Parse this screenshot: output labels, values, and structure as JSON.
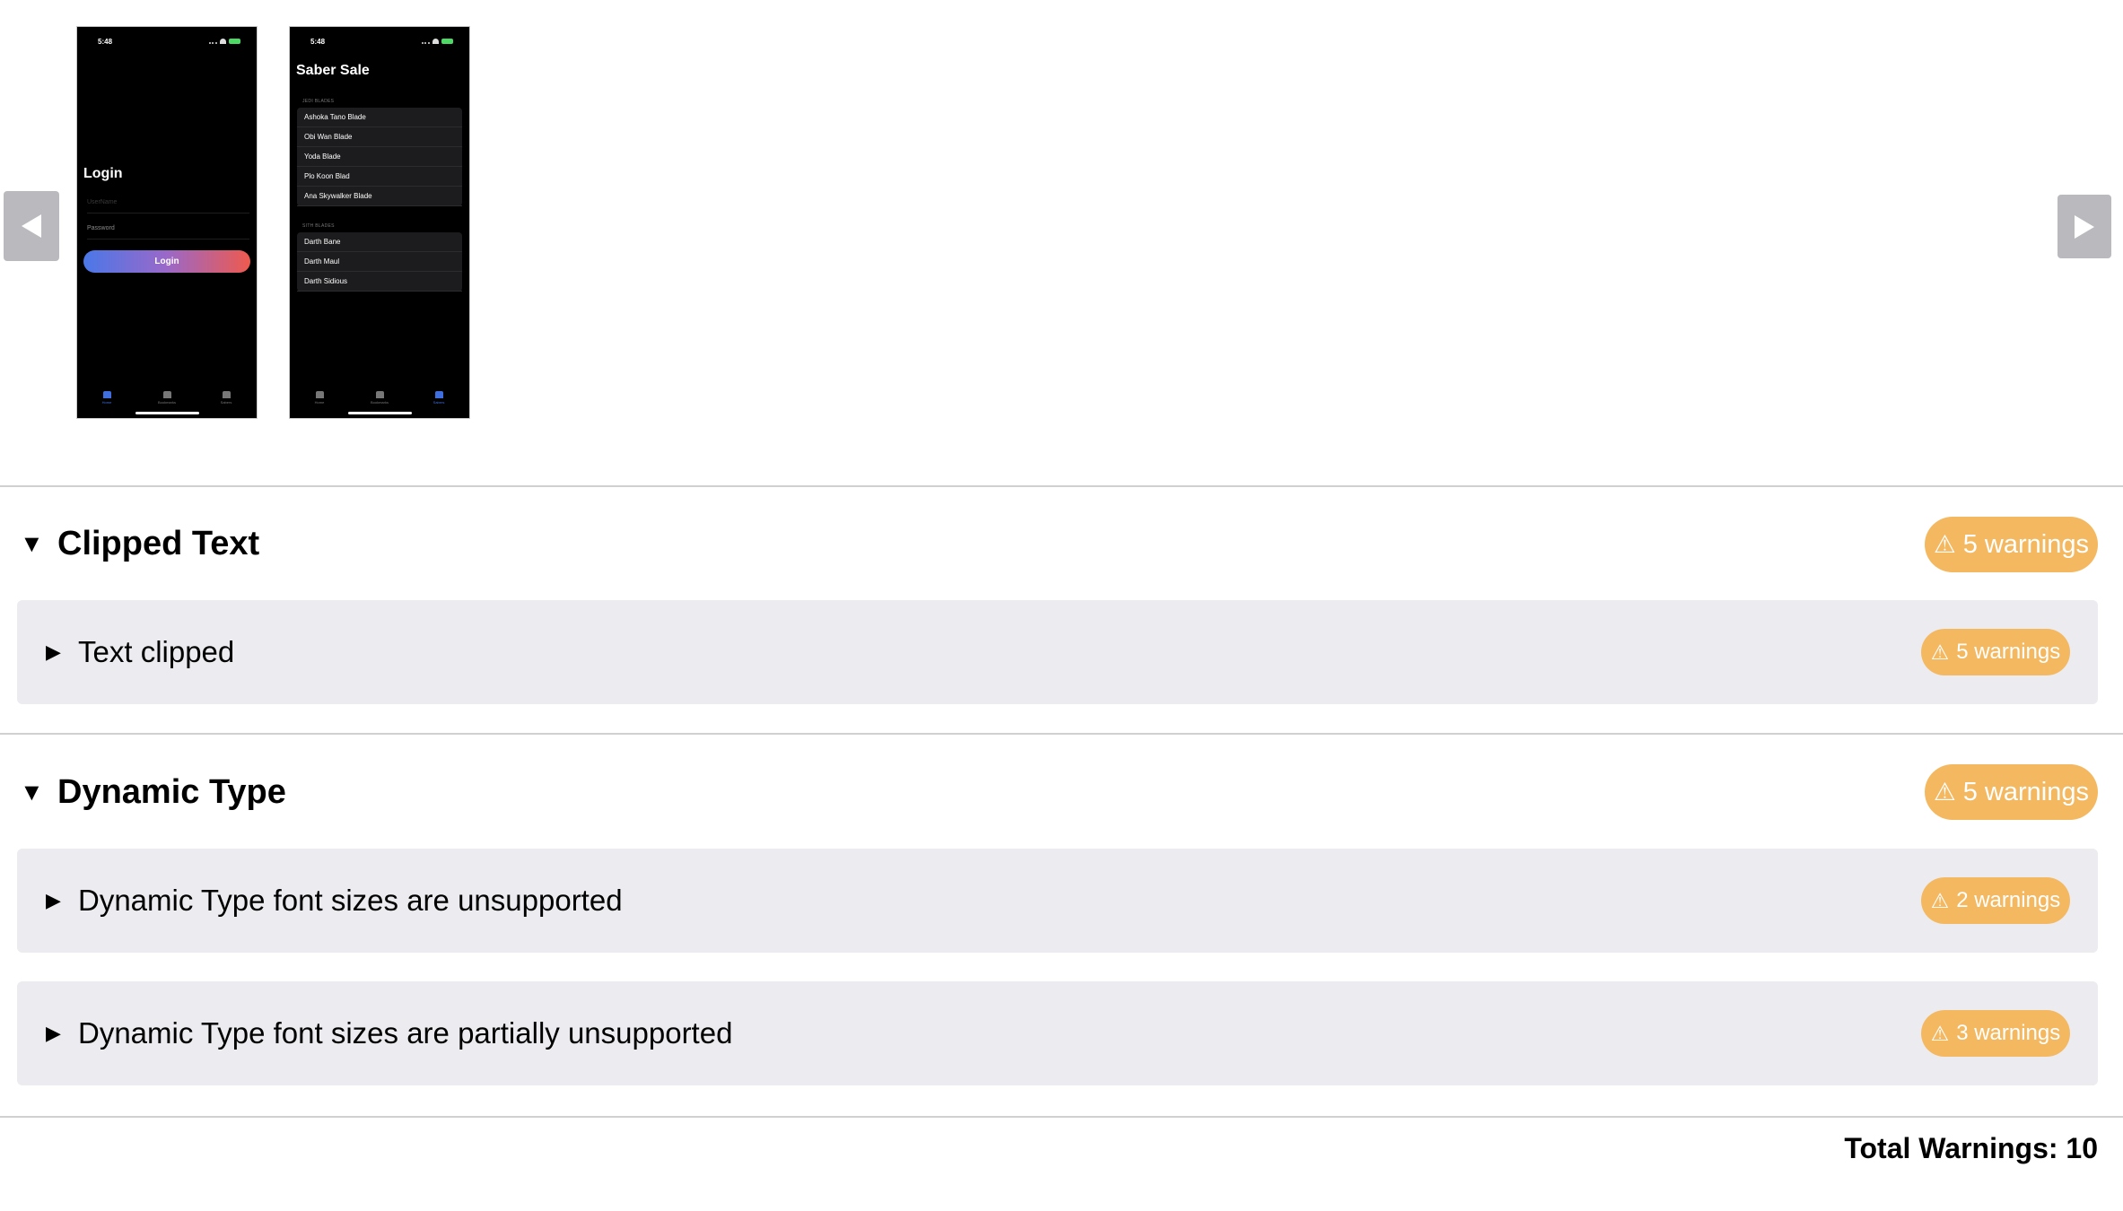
{
  "carousel": {
    "screens": [
      {
        "status_time": "5:48",
        "title": "Login",
        "fields": {
          "username_placeholder": "UserName",
          "password_placeholder": "Password"
        },
        "button": "Login",
        "tabs": [
          "Home",
          "Bookmarks",
          "Sabers"
        ]
      },
      {
        "status_time": "5:48",
        "title": "Saber Sale",
        "sections": [
          {
            "header": "JEDI BLADES",
            "items": [
              "Ashoka Tano Blade",
              "Obi Wan Blade",
              "Yoda Blade",
              "Plo Koon Blad",
              "Ana Skywalker Blade"
            ]
          },
          {
            "header": "SITH BLADES",
            "items": [
              "Darth Bane",
              "Darth Maul",
              "Darth Sidious"
            ]
          }
        ],
        "tabs": [
          "Home",
          "Bookmarks",
          "Sabers"
        ]
      }
    ]
  },
  "sections": [
    {
      "title": "Clipped Text",
      "badge": "5 warnings",
      "items": [
        {
          "label": "Text clipped",
          "badge": "5 warnings"
        }
      ]
    },
    {
      "title": "Dynamic Type",
      "badge": "5 warnings",
      "items": [
        {
          "label": "Dynamic Type font sizes are unsupported",
          "badge": "2 warnings"
        },
        {
          "label": "Dynamic Type font sizes are partially unsupported",
          "badge": "3 warnings"
        }
      ]
    }
  ],
  "icons": {
    "warning": "⚠",
    "expanded": "▼",
    "collapsed": "▶"
  },
  "colors": {
    "badge": "#f4b860",
    "row_bg": "#ebebf0",
    "nav_button": "#b9b9be"
  },
  "footer": {
    "total": "Total Warnings: 10"
  }
}
